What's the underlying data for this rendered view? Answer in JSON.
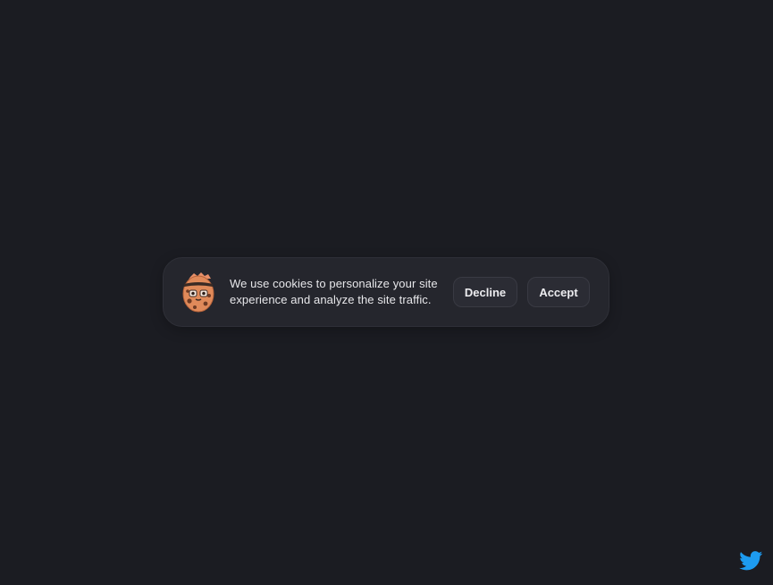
{
  "cookie_banner": {
    "message": "We use cookies to personalize your site experience and analyze the site traffic.",
    "icon": "cookie-mascot-icon",
    "decline_label": "Decline",
    "accept_label": "Accept"
  },
  "footer": {
    "social_icon": "twitter-icon"
  },
  "colors": {
    "background": "#1b1c22",
    "banner_background": "#25262d",
    "button_background": "#2b2c34",
    "twitter_blue": "#1d9bf0",
    "cookie_orange": "#e08a5a"
  }
}
